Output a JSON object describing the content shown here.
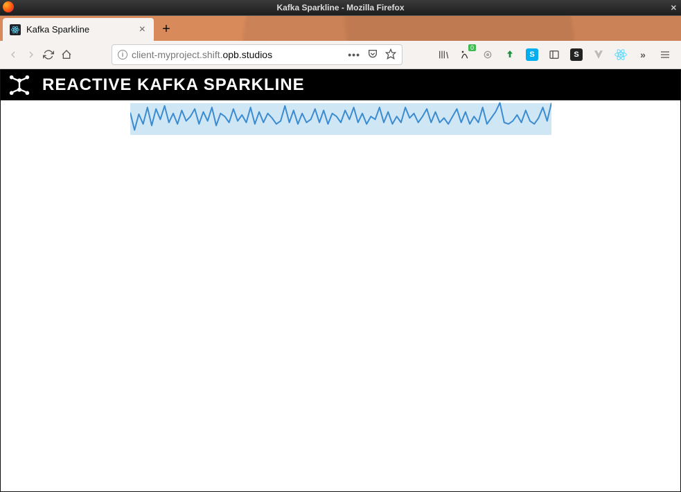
{
  "window": {
    "title": "Kafka Sparkline - Mozilla Firefox"
  },
  "tab": {
    "title": "Kafka Sparkline"
  },
  "url": {
    "raw": "client-myproject.shift.opb.studios",
    "grey_prefix": "client-myproject.shift.",
    "bold_part": "opb.studios"
  },
  "toolbar": {
    "ext_badge": "0"
  },
  "app": {
    "title": "REACTIVE KAFKA SPARKLINE"
  },
  "chart_data": {
    "type": "line",
    "title": "",
    "xlabel": "",
    "ylabel": "",
    "ylim": [
      0,
      55
    ],
    "values": [
      35,
      12,
      33,
      20,
      42,
      18,
      40,
      26,
      44,
      22,
      34,
      20,
      38,
      24,
      30,
      40,
      20,
      36,
      24,
      42,
      18,
      34,
      30,
      22,
      40,
      24,
      32,
      22,
      42,
      20,
      36,
      22,
      34,
      28,
      20,
      24,
      44,
      22,
      38,
      20,
      34,
      22,
      26,
      40,
      22,
      38,
      20,
      34,
      30,
      22,
      38,
      26,
      42,
      22,
      34,
      20,
      30,
      26,
      42,
      22,
      36,
      20,
      30,
      22,
      42,
      28,
      34,
      22,
      30,
      40,
      22,
      36,
      22,
      28,
      20,
      30,
      40,
      22,
      36,
      20,
      30,
      22,
      42,
      20,
      28,
      36,
      48,
      22,
      20,
      24,
      32,
      22,
      38,
      24,
      20,
      28,
      42,
      24,
      48
    ]
  }
}
